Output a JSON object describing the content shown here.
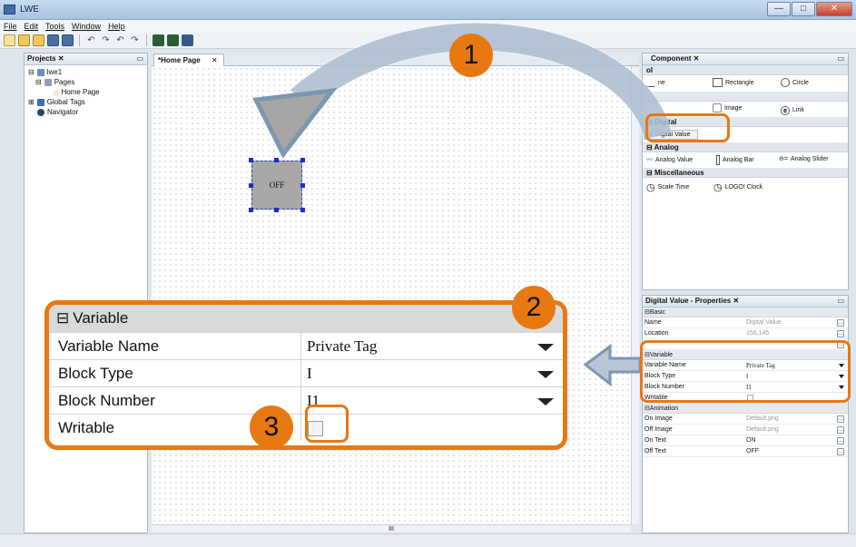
{
  "window": {
    "title": "LWE",
    "controls": [
      "—",
      "□",
      "✕"
    ]
  },
  "menu": [
    "File",
    "Edit",
    "Tools",
    "Window",
    "Help"
  ],
  "toolbar": {
    "icons": [
      "new-icon",
      "open-folder-icon",
      "open-icon",
      "save-icon",
      "save-all-icon",
      "undo-icon",
      "redo-icon",
      "undo-more-icon",
      "redo-more-icon",
      "build-icon",
      "download-icon",
      "settings-icon"
    ]
  },
  "projects": {
    "title": "Projects",
    "items": [
      {
        "label": "lwe1"
      },
      {
        "label": "Pages"
      },
      {
        "label": "Home Page"
      },
      {
        "label": "Global Tags"
      },
      {
        "label": "Navigator"
      }
    ]
  },
  "editor": {
    "tab_label": "*Home Page",
    "widget_text": "OFF",
    "scroll_marker": "III"
  },
  "component": {
    "title": "Component",
    "sections": {
      "basic": "ol",
      "digital": "Digital",
      "analog": "Analog",
      "misc": "Miscellaneous"
    },
    "items": {
      "line": "ne",
      "rectangle": "Rectangle",
      "circle": "Circle",
      "image": "Image",
      "link": "Link",
      "digital_value": "Digital Value",
      "analog_value": "Analog Value",
      "analog_bar": "Analog Bar",
      "analog_slider": "Analog Slider",
      "scale_time": "Scale Time",
      "logo_clock": "LOGO! Clock"
    }
  },
  "properties": {
    "title": "Digital Value - Properties",
    "basic_section": "Basic",
    "basic_rows": [
      {
        "key": "Name",
        "value": "Digital Value"
      },
      {
        "key": "Location",
        "value": "156,145"
      }
    ],
    "variable_section": "Variable",
    "variable_rows": [
      {
        "key": "Variable Name",
        "value": "Private Tag"
      },
      {
        "key": "Block Type",
        "value": "I"
      },
      {
        "key": "Block Number",
        "value": "I1"
      },
      {
        "key": "Writable",
        "value": ""
      }
    ],
    "animation_section": "Animation",
    "animation_rows": [
      {
        "key": "On Image",
        "value": "Default.png"
      },
      {
        "key": "Off Image",
        "value": "Default.png"
      },
      {
        "key": "On Text",
        "value": "ON"
      },
      {
        "key": "Off Text",
        "value": "OFF"
      }
    ]
  },
  "zoom": {
    "section": "Variable",
    "rows": [
      {
        "key": "Variable Name",
        "value": "Private Tag"
      },
      {
        "key": "Block Type",
        "value": "I"
      },
      {
        "key": "Block Number",
        "value": "I1"
      },
      {
        "key": "Writable",
        "value": ""
      }
    ]
  },
  "badges": [
    "1",
    "2",
    "3"
  ],
  "colors": {
    "accent": "#e87812",
    "arrow": "#8ea6bd",
    "selection": "#1b2fc8"
  }
}
